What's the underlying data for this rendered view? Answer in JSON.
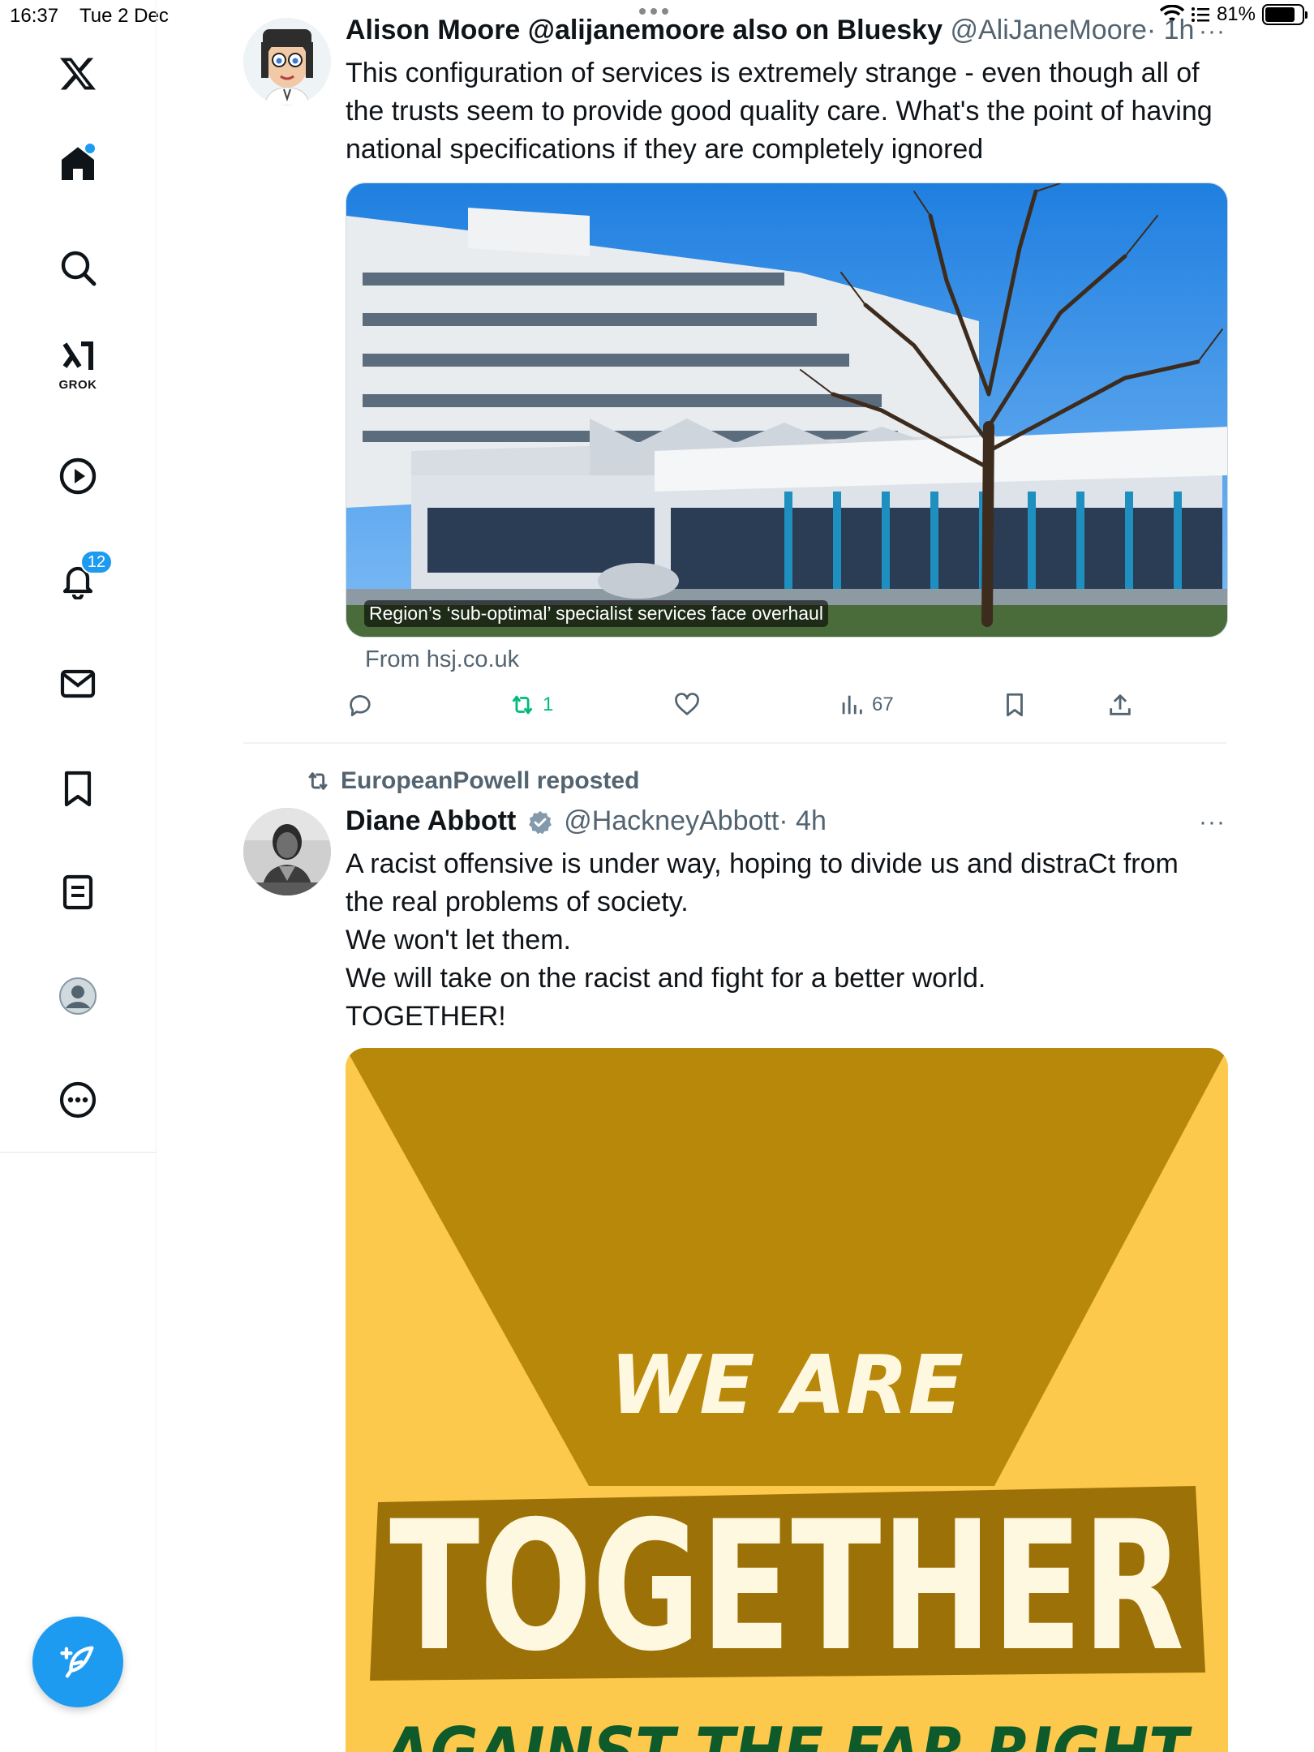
{
  "status_bar": {
    "time": "16:37",
    "date": "Tue 2 Dec",
    "battery": "81%",
    "battery_level": 0.81
  },
  "sidebar": {
    "logo": "x-logo-icon",
    "items": [
      {
        "icon": "home-icon",
        "has_dot": true
      },
      {
        "icon": "search-icon"
      },
      {
        "icon": "grok-icon",
        "label": "GROK"
      },
      {
        "icon": "video-play-icon"
      },
      {
        "icon": "notifications-bell-icon",
        "badge": "12"
      },
      {
        "icon": "messages-envelope-icon"
      },
      {
        "icon": "bookmarks-icon"
      },
      {
        "icon": "lists-icon"
      },
      {
        "icon": "profile-avatar-icon"
      },
      {
        "icon": "more-options-icon"
      }
    ],
    "compose_icon": "compose-post-icon"
  },
  "colors": {
    "accent": "#1d9bf0",
    "text_secondary": "#536471",
    "repost_active": "#00ba7c",
    "banner_dark": "#b8880a",
    "banner_light": "#fcc94c",
    "banner_green": "#0e5a2a"
  },
  "tweets": [
    {
      "display_name": "Alison Moore @alijanemoore also on Bluesky",
      "handle": "@AliJaneMoore",
      "time": "· 1h",
      "text_lines": [
        "This configuration of services is extremely strange - even though all of",
        "the trusts seem to provide good quality care. What's the point of having",
        "national specifications if they are completely ignored"
      ],
      "card_caption": "Region’s ‘sub-optimal’ specialist services face overhaul",
      "card_source": "From hsj.co.uk",
      "reposts": "1",
      "views": "67"
    },
    {
      "reposted_by": "EuropeanPowell reposted",
      "display_name": "Diane Abbott",
      "handle": "@HackneyAbbott",
      "time": "· 4h",
      "text_lines": [
        "A racist offensive is under way, hoping to divide us and distraCt from",
        "the real problems of society.",
        "We won't let them.",
        "We will take on the racist and fight for a better world.",
        "TOGETHER!"
      ],
      "poster": {
        "line1": "WE ARE",
        "line2": "TOGETHER",
        "line3": "AGAINST THE FAR RIGHT"
      }
    }
  ]
}
